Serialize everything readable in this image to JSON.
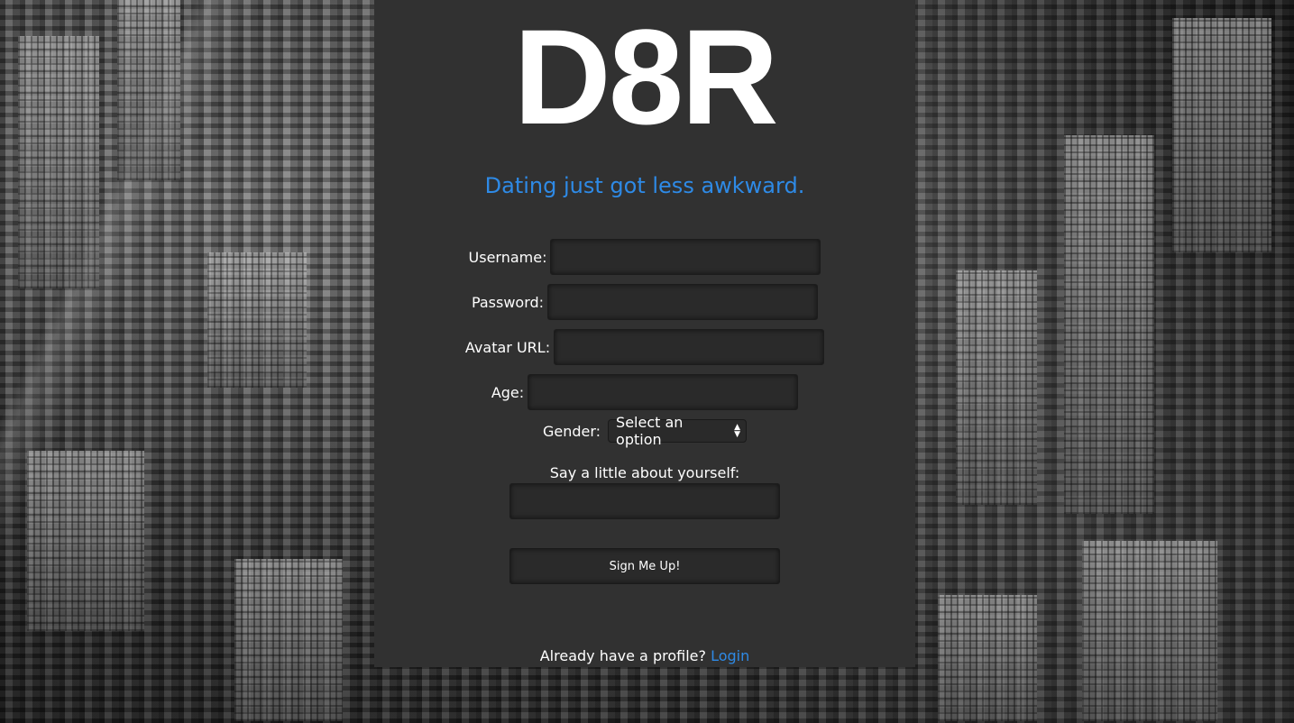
{
  "brand": {
    "logo_text": "D8R",
    "tagline": "Dating just got less awkward."
  },
  "form": {
    "username_label": "Username:",
    "password_label": "Password:",
    "avatar_label": "Avatar URL:",
    "age_label": "Age:",
    "gender_label": "Gender:",
    "gender_selected": "Select an option",
    "about_label": "Say a little about yourself:",
    "submit_label": "Sign Me Up!"
  },
  "footer": {
    "prompt": "Already have a profile?",
    "login_link": "Login"
  },
  "colors": {
    "panel_bg": "#313131",
    "accent": "#2e8ae6",
    "input_bg": "#2a2a2a"
  }
}
